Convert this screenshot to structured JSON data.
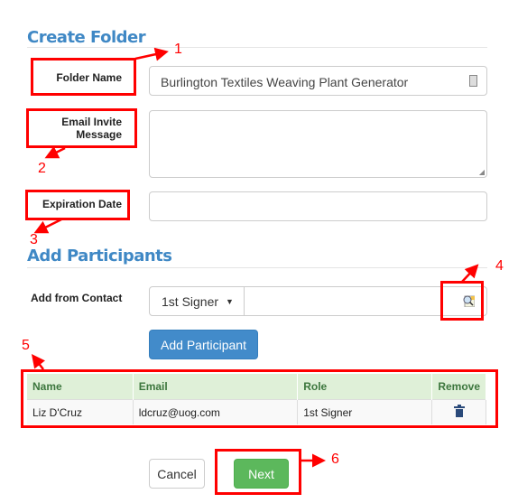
{
  "create_folder": {
    "title": "Create Folder",
    "folder_name_label": "Folder Name",
    "folder_name_value": "Burlington Textiles Weaving Plant Generator",
    "email_invite_label_line1": "Email Invite",
    "email_invite_label_line2": "Message",
    "email_invite_value": "",
    "expiration_label": "Expiration Date",
    "expiration_value": ""
  },
  "participants": {
    "title": "Add Participants",
    "add_from_contact_label": "Add from Contact",
    "role_select": "1st Signer",
    "contact_value": "",
    "add_button": "Add Participant",
    "columns": [
      "Name",
      "Email",
      "Role",
      "Remove"
    ],
    "rows": [
      {
        "name": "Liz D'Cruz",
        "email": "ldcruz@uog.com",
        "role": "1st Signer"
      }
    ]
  },
  "footer": {
    "cancel": "Cancel",
    "next": "Next"
  },
  "annotations": [
    "1",
    "2",
    "3",
    "4",
    "5",
    "6"
  ],
  "colors": {
    "heading": "#3f88c5",
    "primary": "#428bca",
    "success": "#5cb85c",
    "annotation": "#ff0000",
    "table_header": "#dff0d8"
  }
}
